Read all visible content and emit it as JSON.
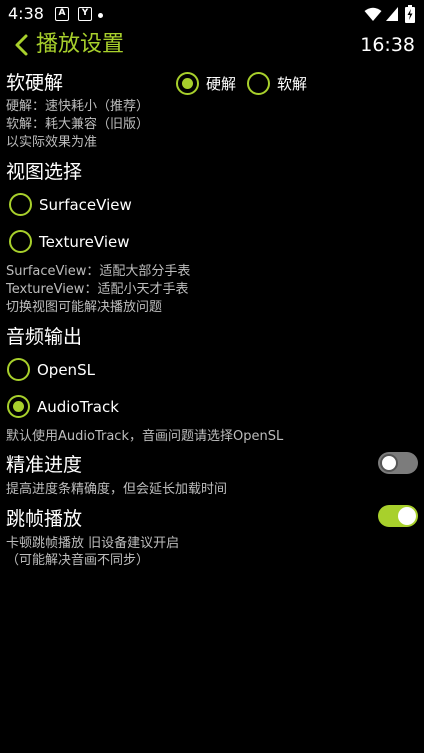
{
  "status_bar": {
    "time": "4:38",
    "notif1": "A",
    "notif2": "Y"
  },
  "header": {
    "title": "播放设置",
    "time": "16:38"
  },
  "decoder": {
    "title": "软硬解",
    "options": [
      {
        "label": "硬解",
        "selected": true
      },
      {
        "label": "软解",
        "selected": false
      }
    ],
    "desc": [
      "硬解：速快耗小（推荐）",
      "软解：耗大兼容（旧版）",
      "以实际效果为准"
    ]
  },
  "view": {
    "title": "视图选择",
    "options": [
      {
        "label": "SurfaceView",
        "selected": false
      },
      {
        "label": "TextureView",
        "selected": false
      }
    ],
    "desc": [
      "SurfaceView：适配大部分手表",
      "TextureView：适配小天才手表",
      "切换视图可能解决播放问题"
    ]
  },
  "audio": {
    "title": "音频输出",
    "options": [
      {
        "label": "OpenSL",
        "selected": false
      },
      {
        "label": "AudioTrack",
        "selected": true
      }
    ],
    "desc": [
      "默认使用AudioTrack，音画问题请选择OpenSL"
    ]
  },
  "precise_seek": {
    "title": "精准进度",
    "enabled": false,
    "desc": [
      "提高进度条精确度，但会延长加载时间"
    ]
  },
  "frame_skip": {
    "title": "跳帧播放",
    "enabled": true,
    "desc": [
      "卡顿跳帧播放 旧设备建议开启",
      "（可能解决音画不同步）"
    ]
  },
  "colors": {
    "accent": "#a8d02c",
    "background": "#000000",
    "secondary_text": "#bdbdbd"
  }
}
